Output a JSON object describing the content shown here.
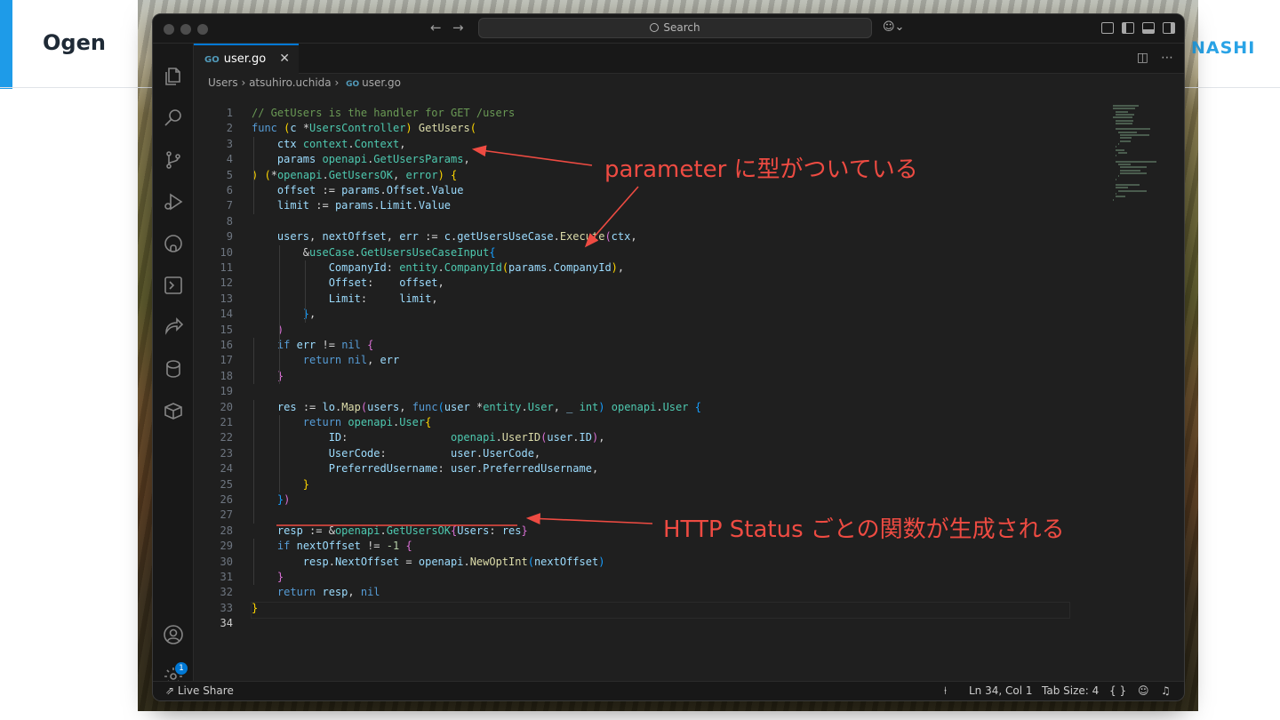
{
  "slide": {
    "title": "Ogen",
    "logo_text": "NASHI"
  },
  "window": {
    "search_placeholder": "Search"
  },
  "tab": {
    "filename": "user.go",
    "lang_icon": "GO",
    "close": "✕"
  },
  "breadcrumb": {
    "part1": "Users",
    "part2": "atsuhiro.uchida",
    "part3": "user.go"
  },
  "code_lines": [
    [
      [
        "cm",
        "// GetUsers is the handler for GET /users"
      ]
    ],
    [
      [
        "kw",
        "func "
      ],
      [
        "br1",
        "("
      ],
      [
        "va",
        "c "
      ],
      [
        "op",
        "*"
      ],
      [
        "ty",
        "UsersController"
      ],
      [
        "br1",
        ")"
      ],
      [
        "fn",
        " GetUsers"
      ],
      [
        "br1",
        "("
      ]
    ],
    [
      [
        "op",
        "    "
      ],
      [
        "va",
        "ctx "
      ],
      [
        "ty",
        "context"
      ],
      [
        "op",
        "."
      ],
      [
        "ty",
        "Context"
      ],
      [
        "op",
        ","
      ]
    ],
    [
      [
        "op",
        "    "
      ],
      [
        "va",
        "params "
      ],
      [
        "ty",
        "openapi"
      ],
      [
        "op",
        "."
      ],
      [
        "ty",
        "GetUsersParams"
      ],
      [
        "op",
        ","
      ]
    ],
    [
      [
        "br1",
        ")"
      ],
      [
        "op",
        " "
      ],
      [
        "br1",
        "("
      ],
      [
        "op",
        "*"
      ],
      [
        "ty",
        "openapi"
      ],
      [
        "op",
        "."
      ],
      [
        "ty",
        "GetUsersOK"
      ],
      [
        "op",
        ", "
      ],
      [
        "ty",
        "error"
      ],
      [
        "br1",
        ")"
      ],
      [
        "op",
        " "
      ],
      [
        "br1",
        "{"
      ]
    ],
    [
      [
        "op",
        "    "
      ],
      [
        "va",
        "offset "
      ],
      [
        "op",
        ":= "
      ],
      [
        "va",
        "params"
      ],
      [
        "op",
        "."
      ],
      [
        "va",
        "Offset"
      ],
      [
        "op",
        "."
      ],
      [
        "va",
        "Value"
      ]
    ],
    [
      [
        "op",
        "    "
      ],
      [
        "va",
        "limit "
      ],
      [
        "op",
        ":= "
      ],
      [
        "va",
        "params"
      ],
      [
        "op",
        "."
      ],
      [
        "va",
        "Limit"
      ],
      [
        "op",
        "."
      ],
      [
        "va",
        "Value"
      ]
    ],
    [],
    [
      [
        "op",
        "    "
      ],
      [
        "va",
        "users"
      ],
      [
        "op",
        ", "
      ],
      [
        "va",
        "nextOffset"
      ],
      [
        "op",
        ", "
      ],
      [
        "va",
        "err "
      ],
      [
        "op",
        ":= "
      ],
      [
        "va",
        "c"
      ],
      [
        "op",
        "."
      ],
      [
        "va",
        "getUsersUseCase"
      ],
      [
        "op",
        "."
      ],
      [
        "fn",
        "Execute"
      ],
      [
        "br2",
        "("
      ],
      [
        "va",
        "ctx"
      ],
      [
        "op",
        ","
      ]
    ],
    [
      [
        "op",
        "        &"
      ],
      [
        "ty",
        "useCase"
      ],
      [
        "op",
        "."
      ],
      [
        "ty",
        "GetUsersUseCaseInput"
      ],
      [
        "br3",
        "{"
      ]
    ],
    [
      [
        "op",
        "            "
      ],
      [
        "va",
        "CompanyId"
      ],
      [
        "op",
        ": "
      ],
      [
        "ty",
        "entity"
      ],
      [
        "op",
        "."
      ],
      [
        "ty",
        "CompanyId"
      ],
      [
        "br1",
        "("
      ],
      [
        "va",
        "params"
      ],
      [
        "op",
        "."
      ],
      [
        "va",
        "CompanyId"
      ],
      [
        "br1",
        ")"
      ],
      [
        "op",
        ","
      ]
    ],
    [
      [
        "op",
        "            "
      ],
      [
        "va",
        "Offset"
      ],
      [
        "op",
        ":    "
      ],
      [
        "va",
        "offset"
      ],
      [
        "op",
        ","
      ]
    ],
    [
      [
        "op",
        "            "
      ],
      [
        "va",
        "Limit"
      ],
      [
        "op",
        ":     "
      ],
      [
        "va",
        "limit"
      ],
      [
        "op",
        ","
      ]
    ],
    [
      [
        "op",
        "        "
      ],
      [
        "br3",
        "}"
      ],
      [
        "op",
        ","
      ]
    ],
    [
      [
        "op",
        "    "
      ],
      [
        "br2",
        ")"
      ]
    ],
    [
      [
        "op",
        "    "
      ],
      [
        "kw",
        "if "
      ],
      [
        "va",
        "err "
      ],
      [
        "op",
        "!= "
      ],
      [
        "kw",
        "nil "
      ],
      [
        "br2",
        "{"
      ]
    ],
    [
      [
        "op",
        "        "
      ],
      [
        "kw",
        "return "
      ],
      [
        "kw",
        "nil"
      ],
      [
        "op",
        ", "
      ],
      [
        "va",
        "err"
      ]
    ],
    [
      [
        "op",
        "    "
      ],
      [
        "br2",
        "}"
      ]
    ],
    [],
    [
      [
        "op",
        "    "
      ],
      [
        "va",
        "res "
      ],
      [
        "op",
        ":= "
      ],
      [
        "va",
        "lo"
      ],
      [
        "op",
        "."
      ],
      [
        "fn",
        "Map"
      ],
      [
        "br2",
        "("
      ],
      [
        "va",
        "users"
      ],
      [
        "op",
        ", "
      ],
      [
        "kw",
        "func"
      ],
      [
        "br3",
        "("
      ],
      [
        "va",
        "user "
      ],
      [
        "op",
        "*"
      ],
      [
        "ty",
        "entity"
      ],
      [
        "op",
        "."
      ],
      [
        "ty",
        "User"
      ],
      [
        "op",
        ", "
      ],
      [
        "va",
        "_ "
      ],
      [
        "ty",
        "int"
      ],
      [
        "br3",
        ")"
      ],
      [
        "op",
        " "
      ],
      [
        "ty",
        "openapi"
      ],
      [
        "op",
        "."
      ],
      [
        "ty",
        "User"
      ],
      [
        "op",
        " "
      ],
      [
        "br3",
        "{"
      ]
    ],
    [
      [
        "op",
        "        "
      ],
      [
        "kw",
        "return "
      ],
      [
        "ty",
        "openapi"
      ],
      [
        "op",
        "."
      ],
      [
        "ty",
        "User"
      ],
      [
        "br1",
        "{"
      ]
    ],
    [
      [
        "op",
        "            "
      ],
      [
        "va",
        "ID"
      ],
      [
        "op",
        ":                "
      ],
      [
        "ty",
        "openapi"
      ],
      [
        "op",
        "."
      ],
      [
        "fn",
        "UserID"
      ],
      [
        "br2",
        "("
      ],
      [
        "va",
        "user"
      ],
      [
        "op",
        "."
      ],
      [
        "va",
        "ID"
      ],
      [
        "br2",
        ")"
      ],
      [
        "op",
        ","
      ]
    ],
    [
      [
        "op",
        "            "
      ],
      [
        "va",
        "UserCode"
      ],
      [
        "op",
        ":          "
      ],
      [
        "va",
        "user"
      ],
      [
        "op",
        "."
      ],
      [
        "va",
        "UserCode"
      ],
      [
        "op",
        ","
      ]
    ],
    [
      [
        "op",
        "            "
      ],
      [
        "va",
        "PreferredUsername"
      ],
      [
        "op",
        ": "
      ],
      [
        "va",
        "user"
      ],
      [
        "op",
        "."
      ],
      [
        "va",
        "PreferredUsername"
      ],
      [
        "op",
        ","
      ]
    ],
    [
      [
        "op",
        "        "
      ],
      [
        "br1",
        "}"
      ]
    ],
    [
      [
        "op",
        "    "
      ],
      [
        "br3",
        "}"
      ],
      [
        "br2",
        ")"
      ]
    ],
    [],
    [
      [
        "op",
        "    "
      ],
      [
        "va",
        "resp "
      ],
      [
        "op",
        ":= &"
      ],
      [
        "ty",
        "openapi"
      ],
      [
        "op",
        "."
      ],
      [
        "ty",
        "GetUsersOK"
      ],
      [
        "br2",
        "{"
      ],
      [
        "va",
        "Users"
      ],
      [
        "op",
        ": "
      ],
      [
        "va",
        "res"
      ],
      [
        "br2",
        "}"
      ]
    ],
    [
      [
        "op",
        "    "
      ],
      [
        "kw",
        "if "
      ],
      [
        "va",
        "nextOffset "
      ],
      [
        "op",
        "!= "
      ],
      [
        "nu",
        "-1 "
      ],
      [
        "br2",
        "{"
      ]
    ],
    [
      [
        "op",
        "        "
      ],
      [
        "va",
        "resp"
      ],
      [
        "op",
        "."
      ],
      [
        "va",
        "NextOffset "
      ],
      [
        "op",
        "= "
      ],
      [
        "va",
        "openapi"
      ],
      [
        "op",
        "."
      ],
      [
        "fn",
        "NewOptInt"
      ],
      [
        "br3",
        "("
      ],
      [
        "va",
        "nextOffset"
      ],
      [
        "br3",
        ")"
      ]
    ],
    [
      [
        "op",
        "    "
      ],
      [
        "br2",
        "}"
      ]
    ],
    [
      [
        "op",
        "    "
      ],
      [
        "kw",
        "return "
      ],
      [
        "va",
        "resp"
      ],
      [
        "op",
        ", "
      ],
      [
        "kw",
        "nil"
      ]
    ],
    [
      [
        "br1",
        "}"
      ]
    ],
    []
  ],
  "statusbar": {
    "live_share": "Live Share",
    "position": "Ln 34, Col 1",
    "tab_size": "Tab Size: 4",
    "braces": "{ }"
  },
  "annotations": {
    "top": "parameter に型がついている",
    "bottom": "HTTP Status ごとの関数が生成される"
  },
  "settings_badge": "1",
  "colors": {
    "annotation": "#ee4b42",
    "accent_bar": "#1e9be8",
    "logo": "#29a3e6"
  }
}
